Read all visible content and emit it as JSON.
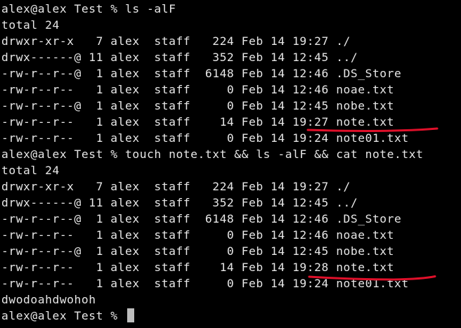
{
  "terminal": {
    "lines": [
      "alex@alex Test % ls -alF",
      "total 24",
      "drwxr-xr-x   7 alex  staff   224 Feb 14 19:27 ./",
      "drwx------@ 11 alex  staff   352 Feb 14 12:45 ../",
      "-rw-r--r--@  1 alex  staff  6148 Feb 14 12:46 .DS_Store",
      "-rw-r--r--   1 alex  staff     0 Feb 14 12:46 noae.txt",
      "-rw-r--r--@  1 alex  staff     0 Feb 14 12:45 nobe.txt",
      "-rw-r--r--   1 alex  staff    14 Feb 14 19:27 note.txt",
      "-rw-r--r--   1 alex  staff     0 Feb 14 19:24 note01.txt",
      "alex@alex Test % touch note.txt && ls -alF && cat note.txt",
      "total 24",
      "drwxr-xr-x   7 alex  staff   224 Feb 14 19:27 ./",
      "drwx------@ 11 alex  staff   352 Feb 14 12:45 ../",
      "-rw-r--r--@  1 alex  staff  6148 Feb 14 12:46 .DS_Store",
      "-rw-r--r--   1 alex  staff     0 Feb 14 12:46 noae.txt",
      "-rw-r--r--@  1 alex  staff     0 Feb 14 12:45 nobe.txt",
      "-rw-r--r--   1 alex  staff    14 Feb 14 19:28 note.txt",
      "-rw-r--r--   1 alex  staff     0 Feb 14 19:24 note01.txt",
      "dwodoahdwohoh"
    ],
    "prompt": "alex@alex Test % ",
    "colors": {
      "background": "#000000",
      "text": "#e6e6e6",
      "cursor": "#bdbdbd",
      "annotation": "#e0102a"
    }
  }
}
